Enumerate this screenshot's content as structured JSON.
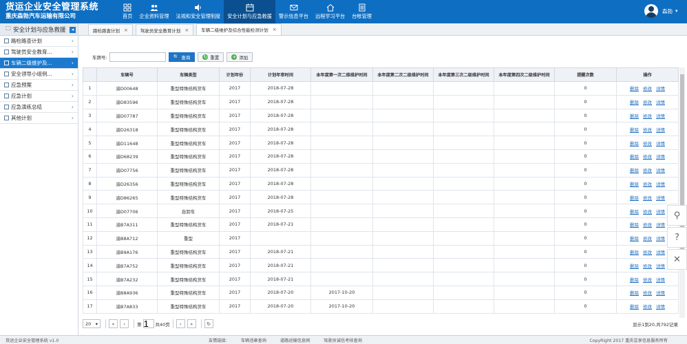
{
  "app": {
    "title": "货运企业安全管理系统",
    "company": "重庆森勃汽车运输有限公司"
  },
  "nav": [
    {
      "label": "首页",
      "icon": "grid-icon",
      "active": false
    },
    {
      "label": "企业资料管理",
      "icon": "users-icon",
      "active": false
    },
    {
      "label": "法规和安全管理制度",
      "icon": "speaker-icon",
      "active": false
    },
    {
      "label": "安全计划与应急救援",
      "icon": "calendar-icon",
      "active": true
    },
    {
      "label": "警示信息平台",
      "icon": "mail-icon",
      "active": false
    },
    {
      "label": "远程学习平台",
      "icon": "home-icon",
      "active": false
    },
    {
      "label": "台帐管理",
      "icon": "ledger-icon",
      "active": false
    }
  ],
  "user": {
    "name": "森勃"
  },
  "sidebar": {
    "title": "安全计划与应急救援",
    "items": [
      {
        "label": "路检路查计划",
        "active": false
      },
      {
        "label": "驾驶员安全教育...",
        "active": false
      },
      {
        "label": "车辆二级维护及...",
        "active": true
      },
      {
        "label": "安全领导小组例...",
        "active": false
      },
      {
        "label": "应急预案",
        "active": false
      },
      {
        "label": "应急计划",
        "active": false
      },
      {
        "label": "应急演练总结",
        "active": false
      },
      {
        "label": "其他计划",
        "active": false
      }
    ]
  },
  "tabs": [
    {
      "label": "路检路查计划",
      "active": false
    },
    {
      "label": "驾驶员安全教育计划",
      "active": false
    },
    {
      "label": "车辆二级维护及综合性能检测计划",
      "active": true
    }
  ],
  "search": {
    "label": "车牌号:",
    "value": "",
    "query_label": "查询",
    "reset_label": "重置",
    "add_label": "添加"
  },
  "table": {
    "headers": [
      "",
      "车辆号",
      "车辆类型",
      "计划年份",
      "计划年审时间",
      "本年度第一次二维维护时间",
      "本年度第二次二级维护时间",
      "本年度第三次二级维护时间",
      "本年度第四次二级维护时间",
      "提醒次数",
      "操作"
    ],
    "ops": [
      "删除",
      "修改",
      "详情"
    ],
    "rows": [
      [
        "1",
        "渝D00648",
        "重型特殊结构货车",
        "2017",
        "2018-07-28",
        "",
        "",
        "",
        "",
        "0"
      ],
      [
        "2",
        "渝D83596",
        "重型特殊结构货车",
        "2017",
        "2018-07-28",
        "",
        "",
        "",
        "",
        "0"
      ],
      [
        "3",
        "渝D07787",
        "重型特殊结构货车",
        "2017",
        "2018-07-28",
        "",
        "",
        "",
        "",
        "0"
      ],
      [
        "4",
        "渝D26318",
        "重型特殊结构货车",
        "2017",
        "2018-07-28",
        "",
        "",
        "",
        "",
        "0"
      ],
      [
        "5",
        "渝D11648",
        "重型特殊结构货车",
        "2017",
        "2018-07-28",
        "",
        "",
        "",
        "",
        "0"
      ],
      [
        "6",
        "渝D68239",
        "重型特殊结构货车",
        "2017",
        "2018-07-28",
        "",
        "",
        "",
        "",
        "0"
      ],
      [
        "7",
        "渝D07756",
        "重型特殊结构货车",
        "2017",
        "2018-07-28",
        "",
        "",
        "",
        "",
        "0"
      ],
      [
        "8",
        "渝D26356",
        "重型特殊结构货车",
        "2017",
        "2018-07-28",
        "",
        "",
        "",
        "",
        "0"
      ],
      [
        "9",
        "渝D86265",
        "重型特殊结构货车",
        "2017",
        "2018-07-28",
        "",
        "",
        "",
        "",
        "0"
      ],
      [
        "10",
        "渝D07706",
        "自卸车",
        "2017",
        "2018-07-25",
        "",
        "",
        "",
        "",
        "0"
      ],
      [
        "11",
        "渝B7A311",
        "重型特殊结构货车",
        "2017",
        "2018-07-21",
        "",
        "",
        "",
        "",
        "0"
      ],
      [
        "12",
        "渝B8A712",
        "重型",
        "2017",
        "",
        "",
        "",
        "",
        "",
        "0"
      ],
      [
        "13",
        "渝B9A176",
        "重型特殊结构货车",
        "2017",
        "2018-07-21",
        "",
        "",
        "",
        "",
        "0"
      ],
      [
        "14",
        "渝B7A752",
        "重型特殊结构货车",
        "2017",
        "2018-07-21",
        "",
        "",
        "",
        "",
        "0"
      ],
      [
        "15",
        "渝B7A232",
        "重型特殊结构货车",
        "2017",
        "2018-07-21",
        "",
        "",
        "",
        "",
        "0"
      ],
      [
        "16",
        "渝B8A936",
        "重型特殊结构货车",
        "2017",
        "2018-07-20",
        "2017-10-20",
        "",
        "",
        "",
        "0"
      ],
      [
        "17",
        "渝B7A833",
        "重型特殊结构货车",
        "2017",
        "2018-07-20",
        "2017-10-20",
        "",
        "",
        "",
        "0"
      ]
    ]
  },
  "pager": {
    "page_size": "20",
    "page_prefix": "第",
    "page_value": "1",
    "page_suffix": "共40页",
    "summary": "显示1到20,共792记录"
  },
  "footer": {
    "left": "货运企业安全管理系统 v1.0",
    "links": [
      "友情链接:",
      "车辆违章查询",
      "道路运输信息网",
      "驾驶员诚信考核查询"
    ],
    "right": "CopyRight 2017 重庆芸享信息服务所有"
  }
}
